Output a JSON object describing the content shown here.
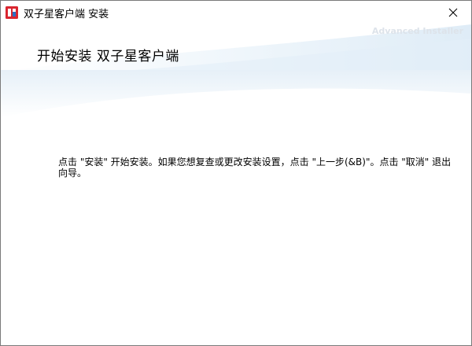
{
  "window": {
    "title": "双子星客户端 安装",
    "close_glyph": "✕"
  },
  "header": {
    "title": "开始安装 双子星客户端",
    "watermark": "Advanced Installer"
  },
  "main": {
    "message": "点击 \"安装\" 开始安装。如果您想复查或更改安装设置，点击 \"上一步(&B)\"。点击 \"取消\" 退出向导。"
  },
  "colors": {
    "app_icon_red": "#d9252f",
    "app_icon_blue": "#2a6fc4",
    "swoosh_blue": "#cfe3f3"
  },
  "icons": {
    "app": "app-icon",
    "close": "close-icon"
  }
}
